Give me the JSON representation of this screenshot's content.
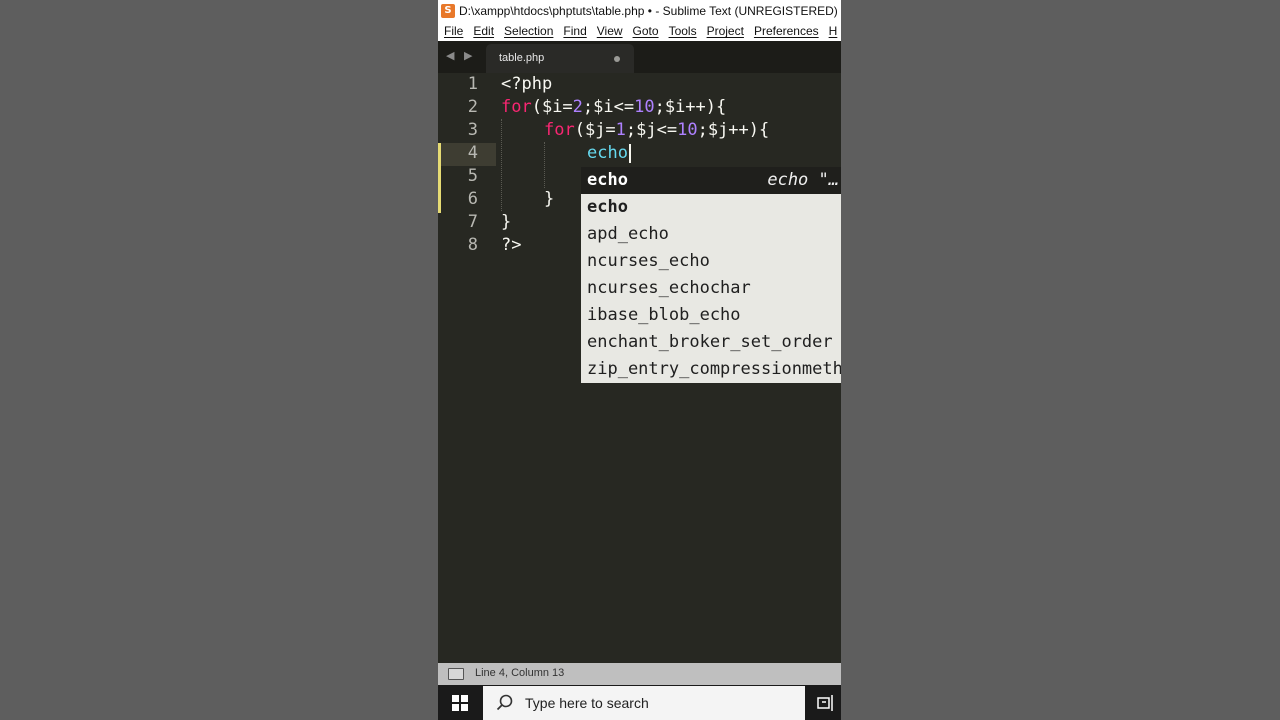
{
  "window": {
    "title": "D:\\xampp\\htdocs\\phptuts\\table.php • - Sublime Text (UNREGISTERED)",
    "logo_letter": "S"
  },
  "menubar": {
    "items": [
      "File",
      "Edit",
      "Selection",
      "Find",
      "View",
      "Goto",
      "Tools",
      "Project",
      "Preferences",
      "H"
    ]
  },
  "tabs": {
    "nav_arrows": "◀ ▶",
    "active": {
      "label": "table.php",
      "modified": true
    }
  },
  "editor": {
    "line_numbers": [
      "1",
      "2",
      "3",
      "4",
      "5",
      "6",
      "7",
      "8"
    ],
    "lines": {
      "l1": "<?php",
      "l2": {
        "kw": "for",
        "p1": "($i=",
        "n1": "2",
        "p2": ";$i<=",
        "n2": "10",
        "p3": ";$i++){"
      },
      "l3": {
        "kw": "for",
        "p1": "($j=",
        "n1": "1",
        "p2": ";$j<=",
        "n2": "10",
        "p3": ";$j++){"
      },
      "l4": "echo",
      "l6": "}",
      "l7": "}",
      "l8": "?>"
    },
    "current_line": 4
  },
  "autocomplete": {
    "items": [
      {
        "label": "echo",
        "hint": "echo \"…"
      },
      {
        "label": "echo"
      },
      {
        "label": "apd_echo"
      },
      {
        "label": "ncurses_echo"
      },
      {
        "label": "ncurses_echochar"
      },
      {
        "label": "ibase_blob_echo"
      },
      {
        "label": "enchant_broker_set_order"
      },
      {
        "label": "zip_entry_compressionmethod"
      }
    ],
    "selected_index": 0
  },
  "statusbar": {
    "position": "Line 4, Column 13"
  },
  "taskbar": {
    "search_placeholder": "Type here to search"
  }
}
